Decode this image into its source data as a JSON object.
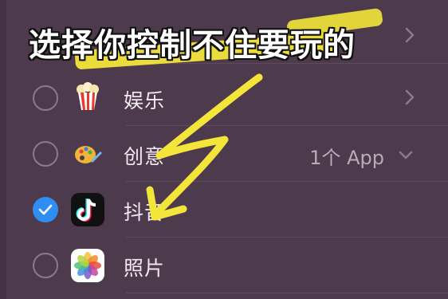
{
  "overlay": {
    "title": "选择你控制不住要玩的"
  },
  "rows": [
    {
      "label": "",
      "checked": false,
      "icon": "blank-category-icon"
    },
    {
      "label": "娱乐",
      "checked": false,
      "icon": "popcorn-icon"
    },
    {
      "label": "创意",
      "checked": false,
      "icon": "paint-palette-icon",
      "count": "1个 App"
    },
    {
      "label": "抖音",
      "checked": true,
      "icon": "tiktok-icon"
    },
    {
      "label": "照片",
      "checked": false,
      "icon": "photos-icon"
    }
  ],
  "colors": {
    "background": "#463045",
    "panel": "#4e3a4d",
    "checkbox": "#2f8ef2",
    "highlight": "#f3e53a"
  }
}
